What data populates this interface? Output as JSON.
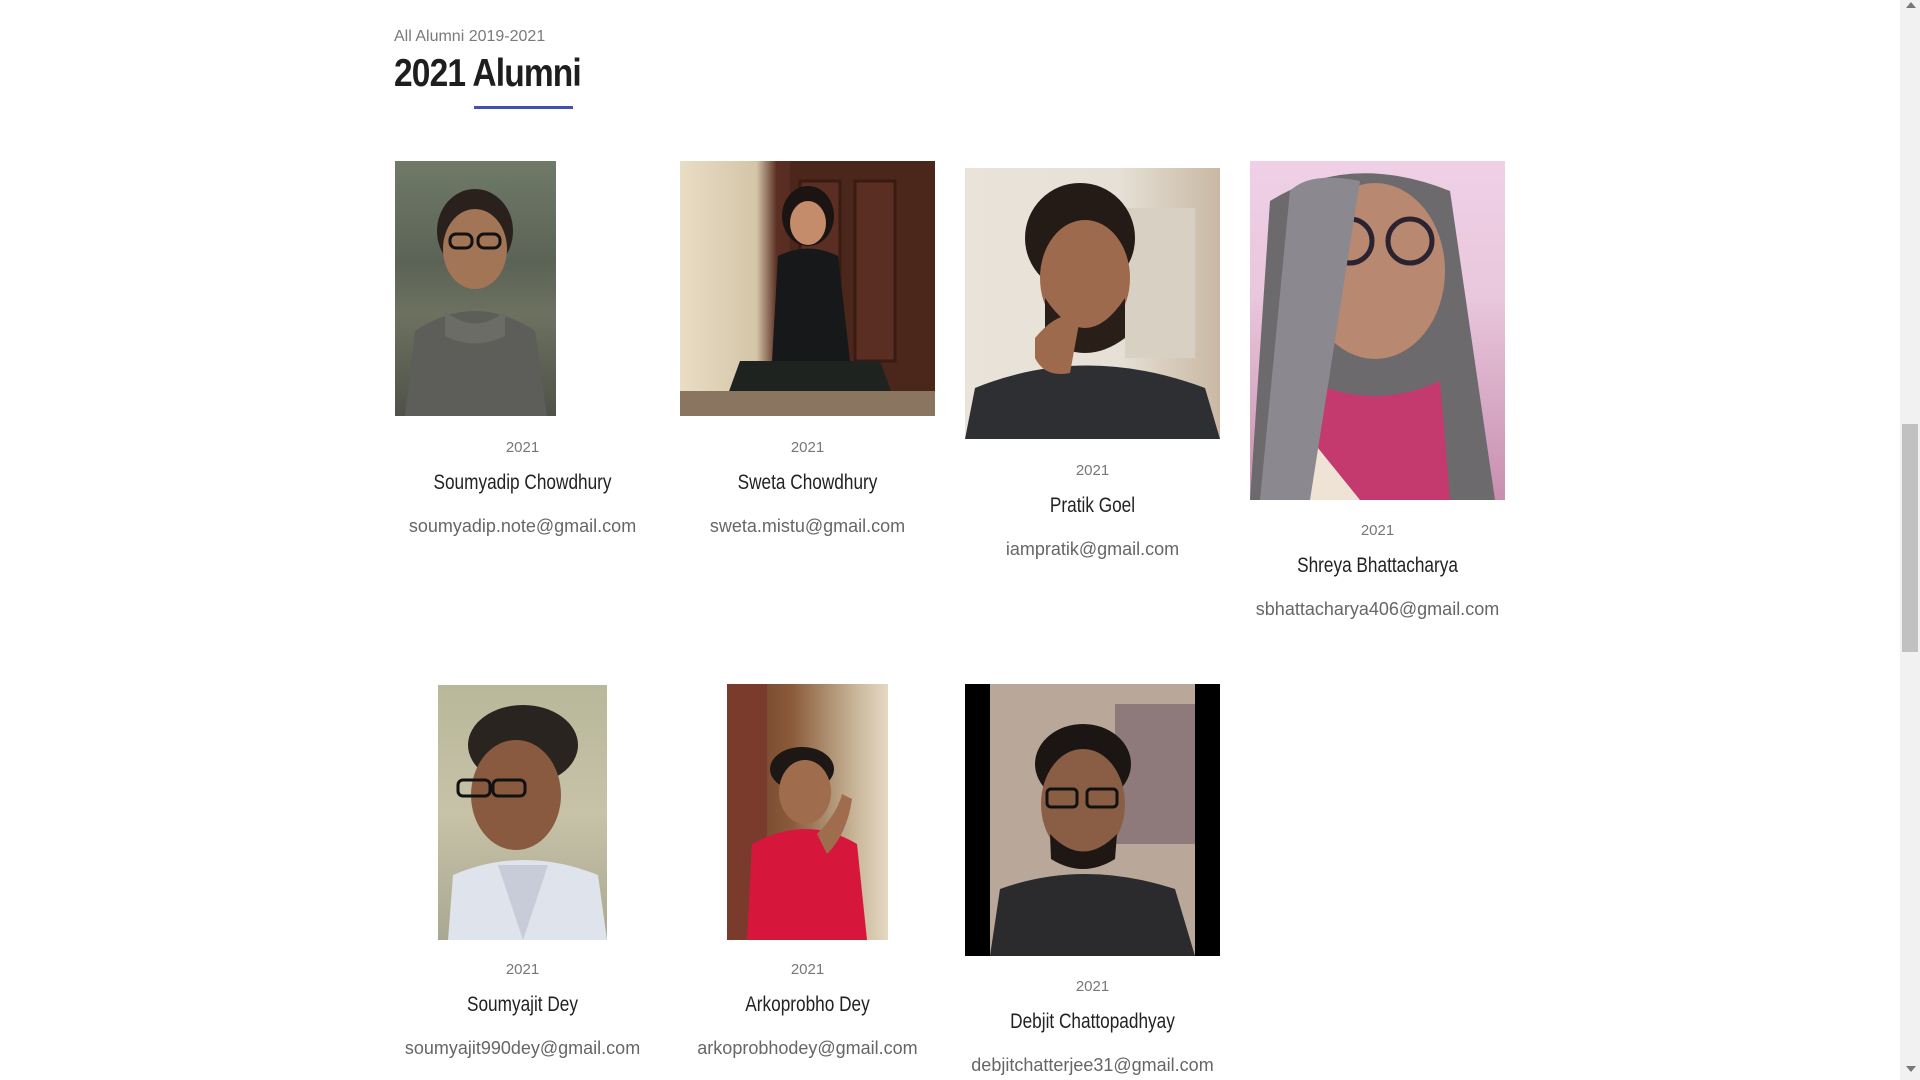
{
  "breadcrumb": "All Alumni 2019-2021",
  "page_title": "2021 Alumni",
  "colors": {
    "accent": "#3f51b5"
  },
  "alumni": [
    {
      "year": "2021",
      "name": "Soumyadip Chowdhury",
      "email": "soumyadip.note@gmail.com"
    },
    {
      "year": "2021",
      "name": "Sweta Chowdhury",
      "email": "sweta.mistu@gmail.com"
    },
    {
      "year": "2021",
      "name": "Pratik Goel",
      "email": "iampratik@gmail.com"
    },
    {
      "year": "2021",
      "name": "Shreya Bhattacharya",
      "email": "sbhattacharya406@gmail.com"
    },
    {
      "year": "2021",
      "name": "Soumyajit Dey",
      "email": "soumyajit990dey@gmail.com"
    },
    {
      "year": "2021",
      "name": "Arkoprobho Dey",
      "email": "arkoprobhodey@gmail.com"
    },
    {
      "year": "2021",
      "name": "Debjit Chattopadhyay",
      "email": "debjitchatterjee31@gmail.com"
    }
  ]
}
